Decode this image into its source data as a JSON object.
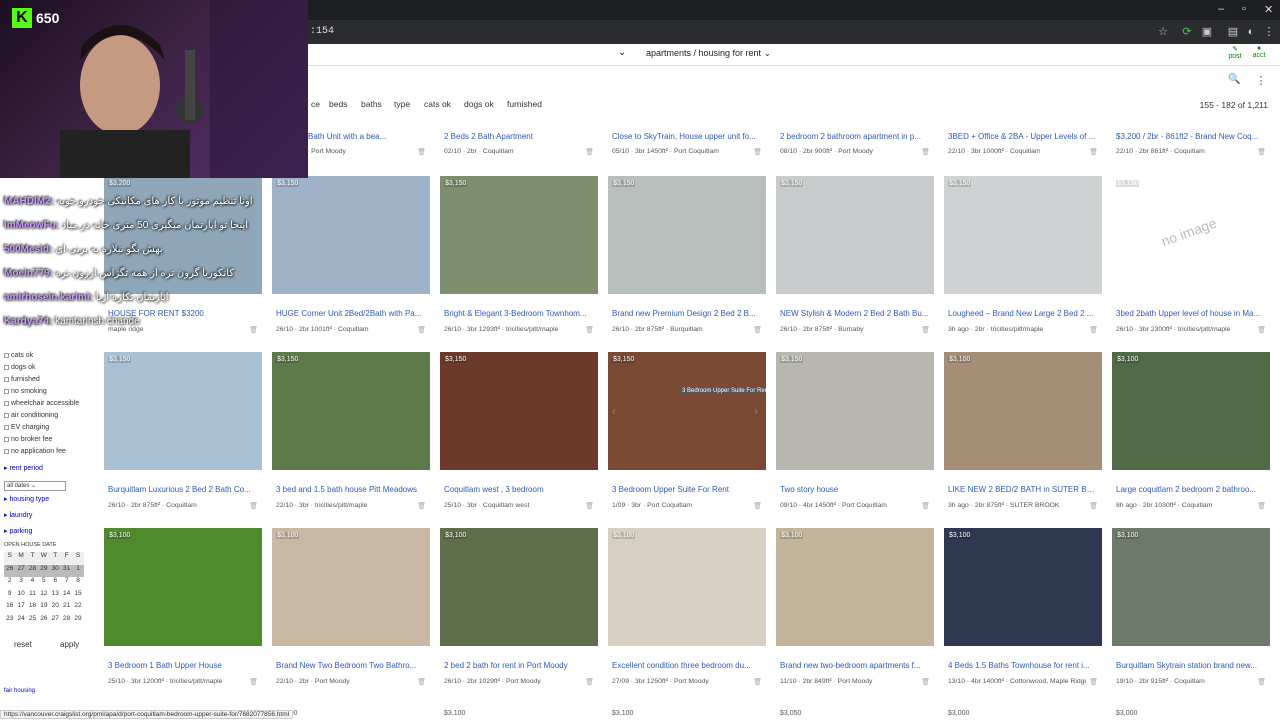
{
  "browser": {
    "url_fragment": ":154",
    "status_url": "https://vancouver.craigslist.org/pml/apa/d/port-coquitlam-bedroom-upper-suite-for/7682077856.html"
  },
  "category": {
    "label": "apartments / housing for rent"
  },
  "header": {
    "post_label": "post",
    "account_label": "acct"
  },
  "filters": [
    "ce",
    "beds",
    "baths",
    "type",
    "cats ok",
    "dogs ok",
    "furnished"
  ],
  "result_count": "155 - 182 of 1,211",
  "left_panel": {
    "checkboxes": [
      "cats ok",
      "dogs ok",
      "furnished",
      "no smoking",
      "wheelchair accessible",
      "air conditioning",
      "EV charging",
      "no broker fee",
      "no application fee"
    ],
    "rent_period": "rent period",
    "date_option": "all dates",
    "links": [
      "housing type",
      "laundry",
      "parking"
    ],
    "open_house_label": "OPEN HOUSE DATE",
    "calendar_head": [
      "S",
      "M",
      "T",
      "W",
      "T",
      "F",
      "S"
    ],
    "calendar_rows": [
      [
        "26",
        "27",
        "28",
        "29",
        "30",
        "31",
        "1"
      ],
      [
        "2",
        "3",
        "4",
        "5",
        "6",
        "7",
        "8"
      ],
      [
        "9",
        "10",
        "11",
        "12",
        "13",
        "14",
        "15"
      ],
      [
        "16",
        "17",
        "18",
        "19",
        "20",
        "21",
        "22"
      ],
      [
        "23",
        "24",
        "25",
        "26",
        "27",
        "28",
        "29"
      ]
    ],
    "reset_label": "reset",
    "apply_label": "apply",
    "fair_housing": "fair housing"
  },
  "overlay": {
    "kick_count": "650",
    "chat": [
      {
        "user": "MAHDIM2:",
        "text": "اونا تنظیم موتور با کار های مکانیکی خودرو خوبه"
      },
      {
        "user": "ImMeowFu:",
        "text": "اینجا تو اپارتمان میگیری 50 متری خانه در میاد"
      },
      {
        "user": "500Mesid:",
        "text": "بهش بگو نبلاره به برنی ای"
      },
      {
        "user": "Moein779:",
        "text": "کانکوریا گرون تره از همه تگزاس ارزون تره"
      },
      {
        "user": "amirhosein.karimi:",
        "text": "اپارتمان تکاره اریا"
      },
      {
        "user": "Kardya74:",
        "text": "kamtarinsh chande"
      }
    ]
  },
  "listings_row0": [
    {
      "title": "2 Bed, 2 Bath Unit with a bea...",
      "meta": "2br 806ft² · Port Moody"
    },
    {
      "title": "2 Beds 2 Bath Apartment",
      "meta": "02/10 · 2br · Coquitlam"
    },
    {
      "title": "Close to SkyTrain, House upper unit fo...",
      "meta": "05/10 · 3br 1450ft² · Port Coquitlam"
    },
    {
      "title": "2 bedroom 2 bathroom apartment in p...",
      "meta": "08/10 · 2br 900ft² · Port Moody"
    },
    {
      "title": "3BED + Office & 2BA - Upper Levels of ...",
      "meta": "22/10 · 3br 1000ft² · Coquitlam"
    },
    {
      "title": "$3,200 / 2br - 861ft2 - Brand New Coq...",
      "meta": "22/10 · 2br 861ft² · Coquitlam"
    }
  ],
  "listings": [
    {
      "price": "$3,200",
      "title": "HOUSE FOR RENT $3200",
      "meta": "maple ridge",
      "color": "#8fa7b8"
    },
    {
      "price": "$3,150",
      "title": "HUGE Corner Unit 2Bed/2Bath with Pa...",
      "meta": "26/10 · 2br 1001ft² · Coquitlam",
      "color": "#9fb3c8"
    },
    {
      "price": "$3,150",
      "title": "Bright & Elegant 3-Bedroom Townhom...",
      "meta": "26/10 · 3br 1293ft² · tricities/pitt/maple",
      "color": "#7e8f70"
    },
    {
      "price": "$3,150",
      "title": "Brand new Premium Design 2 Bed 2 B...",
      "meta": "26/10 · 2br 875ft² · Burquitlam",
      "color": "#b9bfbd"
    },
    {
      "price": "$3,150",
      "title": "NEW Stylish & Modern 2 Bed 2 Bath Bu...",
      "meta": "26/10 · 2br 875ft² · Burnaby",
      "color": "#c9cccc"
    },
    {
      "price": "$3,150",
      "title": "Lougheed – Brand New Large 2 Bed 2 ...",
      "meta": "3h ago · 2br · tricities/pitt/maple",
      "color": "#d0d3d3"
    },
    {
      "price": "$3,150",
      "title": "3bed 2bath Upper level of house in Ma...",
      "meta": "26/10 · 3br 2300ft² · tricities/pitt/maple",
      "color": "#ffffff",
      "noimage": "no image"
    },
    {
      "price": "$3,150",
      "title": "Burquitlam Luxurious 2 Bed 2 Bath Co...",
      "meta": "26/10 · 2br 875ft² · Coquitlam",
      "color": "#a9c1d3"
    },
    {
      "price": "$3,150",
      "title": "3 bed and 1.5 bath house Pitt Meadows",
      "meta": "22/10 · 3br · tricities/pitt/maple",
      "color": "#5d7a4a"
    },
    {
      "price": "$3,150",
      "title": "Coquitlam west , 3 bedroom",
      "meta": "25/10 · 3br · Coquitlam west",
      "color": "#6b3a2a"
    },
    {
      "price": "$3,150",
      "title": "3 Bedroom Upper Suite For Rent",
      "meta": "1/09 · 3br · Port Coquitlam",
      "color": "#7a4a35",
      "tooltip": "3 Bedroom Upper Suite For Rent"
    },
    {
      "price": "$3,150",
      "title": "Two story house",
      "meta": "09/10 · 4br 1450ft² · Port Coquitlam",
      "color": "#b8b8b0"
    },
    {
      "price": "$3,100",
      "title": "LIKE NEW 2 BED/2 BATH in SUTER BRO...",
      "meta": "3h ago · 2br 875ft² · SUTER BROOK",
      "color": "#a58e76"
    },
    {
      "price": "$3,100",
      "title": "Large coquitlam 2 bedroom 2 bathroo...",
      "meta": "8h ago · 2br 1030ft² · Coquitlam",
      "color": "#4f6a45"
    },
    {
      "price": "$3,100",
      "title": "3 Bedroom 1 Bath Upper House",
      "meta": "25/10 · 3br 1200ft² · tricities/pitt/maple",
      "color": "#4f8a2e"
    },
    {
      "price": "$3,100",
      "title": "Brand New Two Bedroom Two Bathro...",
      "meta": "22/10 · 2br · Port Moody",
      "color": "#c9b8a3"
    },
    {
      "price": "$3,100",
      "title": "2 bed 2 bath for rent in Port Moody",
      "meta": "26/10 · 2br 1029ft² · Port Moody",
      "color": "#5f6e4b"
    },
    {
      "price": "$3,100",
      "title": "Excellent condition three bedroom du...",
      "meta": "27/09 · 3br 1250ft² · Port Moody",
      "color": "#d8cfc3"
    },
    {
      "price": "$3,100",
      "title": "Brand new two-bedroom apartments f...",
      "meta": "11/10 · 2br 849ft² · Port Moody",
      "color": "#c4b49c"
    },
    {
      "price": "$3,100",
      "title": "4 Beds 1.5 Baths Townhouse for rent i...",
      "meta": "13/10 · 4br 1400ft² · Cottonwood, Maple Ridge",
      "color": "#2e3850"
    },
    {
      "price": "$3,100",
      "title": "Burquitlam Skytrain station brand new...",
      "meta": "19/10 · 2br 915ft² · Coquitlam",
      "color": "#6d7a6a"
    }
  ],
  "next_row_prices": [
    "$3,100",
    "$3,100",
    "$3,100",
    "$3,050",
    "$3,000",
    "$3,000"
  ]
}
